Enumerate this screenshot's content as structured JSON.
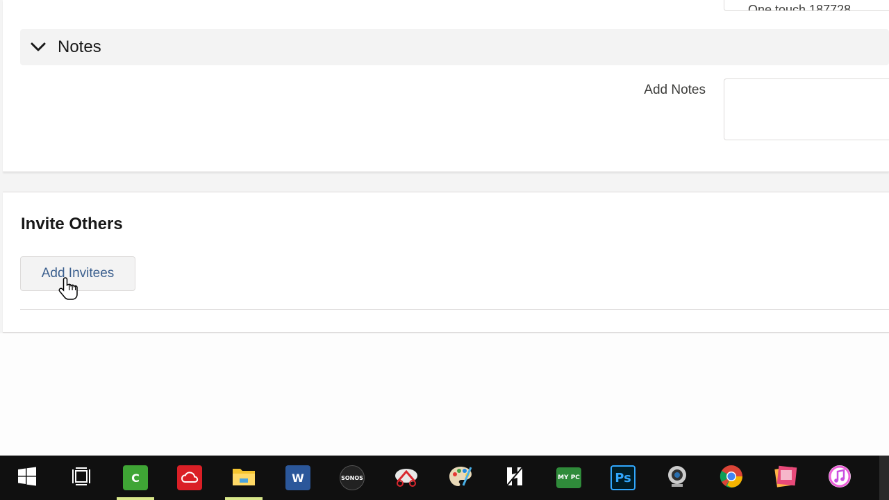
{
  "top_field": {
    "partial_text": "One touch    187728"
  },
  "notes_section": {
    "title": "Notes",
    "field_label": "Add Notes",
    "field_value": ""
  },
  "invite_section": {
    "title": "Invite Others",
    "add_button_label": "Add Invitees"
  },
  "taskbar": {
    "items": [
      {
        "name": "windows-start",
        "icon": "windows-logo-icon",
        "color": "#ffffff"
      },
      {
        "name": "task-view",
        "icon": "task-view-icon",
        "color": "#ffffff"
      },
      {
        "name": "camtasia",
        "icon": "camtasia-icon",
        "color": "#3fa535",
        "active": true
      },
      {
        "name": "adobe-creative-cloud",
        "icon": "creative-cloud-icon",
        "color": "#da1f26"
      },
      {
        "name": "file-explorer",
        "icon": "folder-icon",
        "color": "#f4c430",
        "active": true
      },
      {
        "name": "word",
        "icon": "word-icon",
        "color": "#2b579a"
      },
      {
        "name": "sonos",
        "icon": "sonos-icon",
        "color": "#222222",
        "label": "SONOS"
      },
      {
        "name": "snipping-tool",
        "icon": "snipping-tool-icon",
        "color": "#e8e8e8"
      },
      {
        "name": "paint",
        "icon": "paint-palette-icon",
        "color": "#4ab0e8"
      },
      {
        "name": "app-h",
        "icon": "h-app-icon",
        "color": "#ffffff"
      },
      {
        "name": "my-pc",
        "icon": "my-pc-icon",
        "color": "#2f8b3a",
        "label": "MY PC"
      },
      {
        "name": "photoshop",
        "icon": "photoshop-icon",
        "color": "#001d26",
        "label": "Ps"
      },
      {
        "name": "webcam",
        "icon": "webcam-icon",
        "color": "#cccccc"
      },
      {
        "name": "chrome",
        "icon": "chrome-icon",
        "color": "#db4437"
      },
      {
        "name": "photo-app",
        "icon": "photo-app-icon",
        "color": "#e84a7a"
      },
      {
        "name": "itunes",
        "icon": "itunes-icon",
        "color": "#ec5fd8"
      }
    ]
  }
}
